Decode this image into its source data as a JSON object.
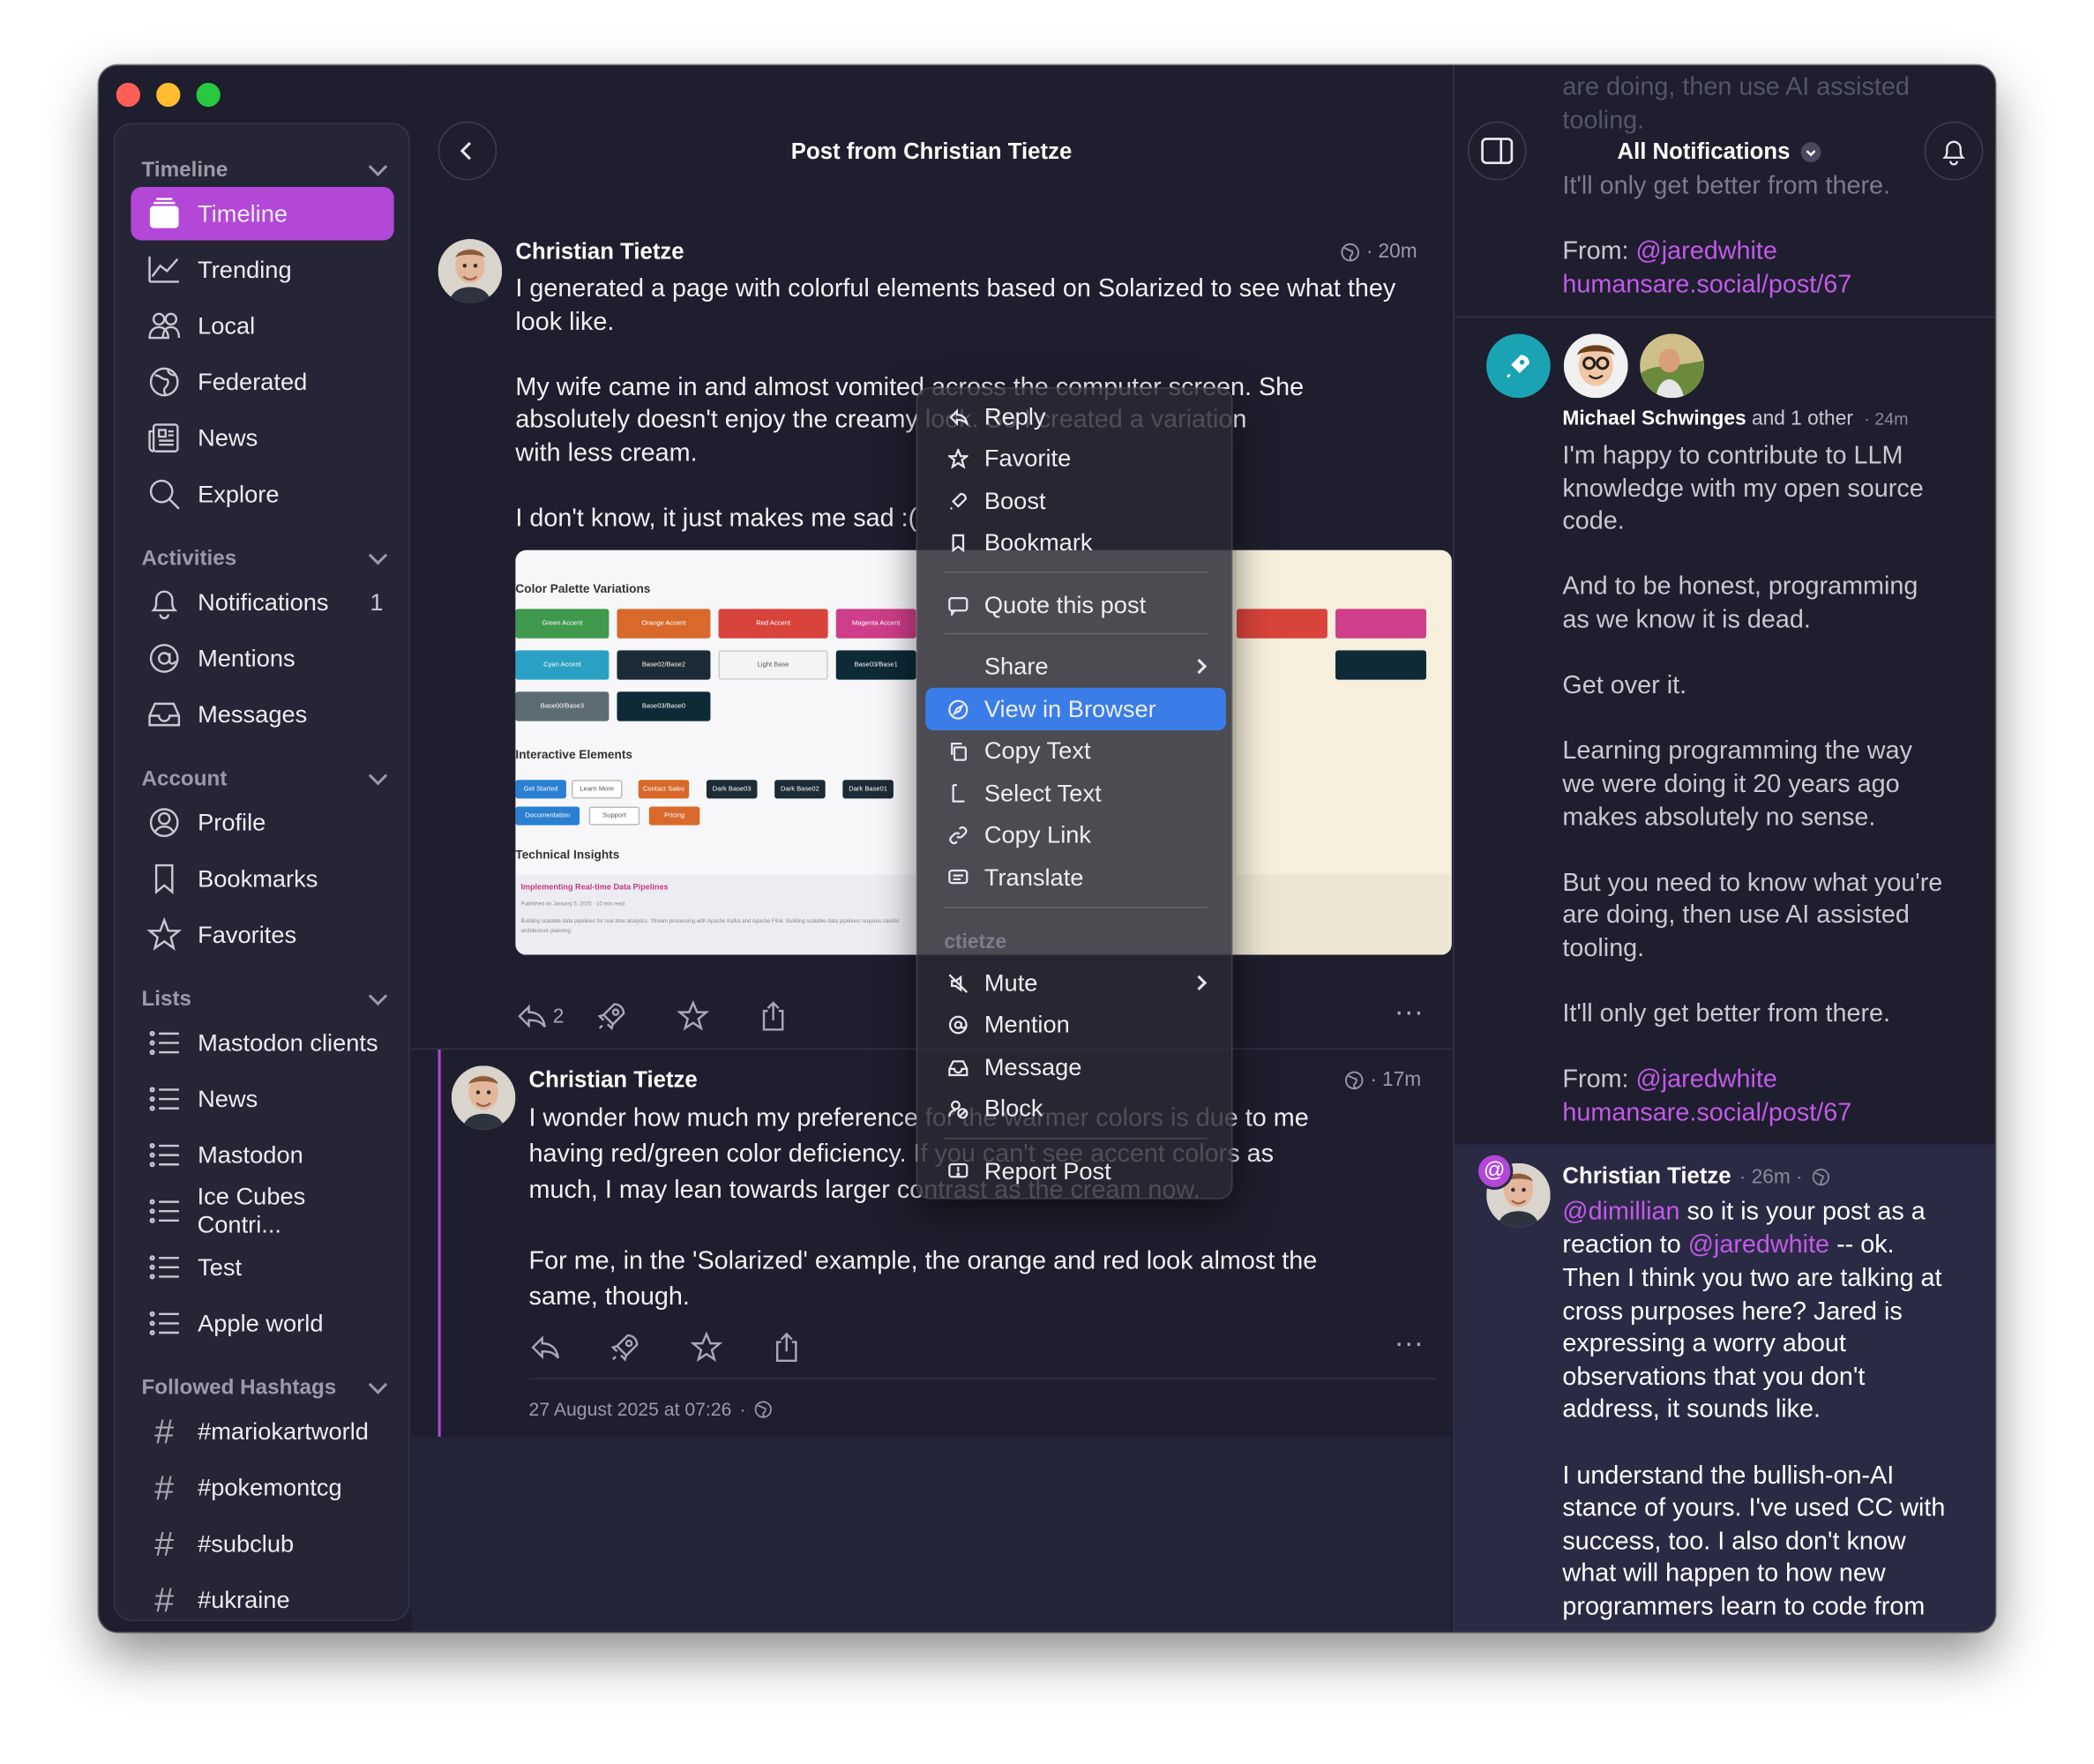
{
  "sidebar": {
    "timeline_section": "Timeline",
    "timeline_items": [
      "Timeline",
      "Trending",
      "Local",
      "Federated",
      "News",
      "Explore"
    ],
    "activities_section": "Activities",
    "activities_items": [
      "Notifications",
      "Mentions",
      "Messages"
    ],
    "notifications_count": "1",
    "account_section": "Account",
    "account_items": [
      "Profile",
      "Bookmarks",
      "Favorites"
    ],
    "lists_section": "Lists",
    "lists_items": [
      "Mastodon clients",
      "News",
      "Mastodon",
      "Ice Cubes Contri...",
      "Test",
      "Apple world"
    ],
    "hashtags_section": "Followed Hashtags",
    "hashtags": [
      "#mariokartworld",
      "#pokemontcg",
      "#subclub",
      "#ukraine"
    ]
  },
  "center": {
    "title": "Post from Christian Tietze",
    "post1": {
      "author": "Christian Tietze",
      "time": "20m",
      "lines": [
        "I generated a page with colorful elements based on Solarized to see what they",
        "look like.",
        "",
        "My wife came in and almost vomited across the computer screen. She",
        "absolutely doesn't enjoy the creamy look. So I created a variation",
        "with less cream.",
        "",
        "I don't know, it just makes me sad :("
      ],
      "reply_count": "2",
      "image": {
        "heading1": "Color Palette Variations",
        "heading2": "Interactive Elements",
        "heading3": "Technical Insights",
        "article": "Implementing Real-time Data Pipelines",
        "article_meta": "Published on January 5, 2025 · 10 min read",
        "article_body": "Building scalable data pipelines for real-time analytics. Stream processing with Apache Kafka and Apache Flink. Building scalable data pipelines requires careful architecture planning.",
        "swatches": [
          "Green Accent",
          "Orange Accent",
          "Red Accent",
          "Magenta Accent",
          "Cyan Accent",
          "Base02/Base2",
          "Light Base",
          "Base03/Base1",
          "Base00/Base3",
          "Base03/Base0"
        ],
        "buttons": [
          "Get Started",
          "Learn More",
          "Contact Sales",
          "Dark Base03",
          "Dark Base02",
          "Dark Base01",
          "Documentation",
          "Support",
          "Pricing"
        ]
      }
    },
    "post2": {
      "author": "Christian Tietze",
      "time": "17m",
      "lines": [
        "I wonder how much my preference for the warmer colors is due to me",
        "having red/green color deficiency. If you can't see accent colors as",
        "much, I may lean towards larger contrast as the cream now.",
        "",
        "For me, in the 'Solarized' example, the orange and red look almost the",
        "same, though."
      ],
      "timestamp": "27 August 2025 at 07:26"
    }
  },
  "menu": {
    "items1": [
      "Reply",
      "Favorite",
      "Boost",
      "Bookmark"
    ],
    "quote": "Quote this post",
    "share": "Share",
    "items2": [
      "View in Browser",
      "Copy Text",
      "Select Text",
      "Copy Link",
      "Translate"
    ],
    "section": "ctietze",
    "items3": [
      "Mute",
      "Mention",
      "Message",
      "Block"
    ],
    "report": "Report Post"
  },
  "right": {
    "title": "All Notifications",
    "top_fade": [
      "are doing, then use AI assisted",
      "tooling."
    ],
    "top_text": "It'll only get better from there.",
    "top_from": "From: ",
    "top_handle": "@jaredwhite",
    "top_link": "humansare.social/post/67",
    "notif": {
      "author": "Michael Schwinges",
      "others": " and 1 other",
      "time": "· 24m",
      "lines": [
        "I'm happy to contribute to LLM",
        "knowledge with my open source",
        "code.",
        "",
        "And to be honest, programming",
        "as we know it is dead.",
        "",
        "Get over it.",
        "",
        "Learning programming the way",
        "we were doing it 20 years ago",
        "makes absolutely no sense.",
        "",
        "But you need to know what you're",
        "are doing, then use AI assisted",
        "tooling.",
        "",
        "It'll only get better from there.",
        "",
        "From: @jaredwhite",
        "humansare.social/post/67"
      ]
    },
    "mention": {
      "author": "Christian Tietze",
      "time": "· 26m ·",
      "line1_handle": "@dimillian",
      "line1_rest": " so it is your post as a",
      "line2_pre": "reaction to ",
      "line2_handle": "@jaredwhite",
      "line2_rest": " -- ok.",
      "lines": [
        "Then I think you two are talking at",
        "cross purposes here? Jared is",
        "expressing a worry about",
        "observations that you don't",
        "address, it sounds like.",
        "",
        "I understand the bullish-on-AI",
        "stance of yours. I've used CC with",
        "success, too. I also don't know",
        "what will happen to how new",
        "programmers learn to code from"
      ]
    }
  },
  "colors": {
    "accent": "#b247d8",
    "link": "#c25ae8",
    "menu_highlight": "#3b7de8",
    "window_bg": "#1e1e2e"
  }
}
